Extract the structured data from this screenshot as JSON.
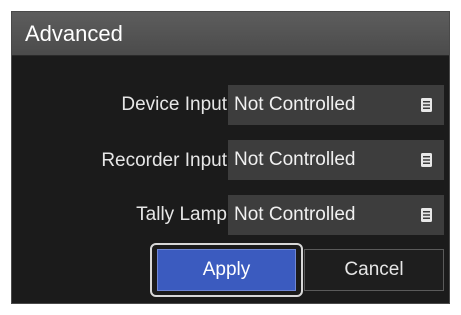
{
  "dialog": {
    "title": "Advanced"
  },
  "fields": [
    {
      "label": "Device Input",
      "value": "Not Controlled",
      "icon": "list-icon"
    },
    {
      "label": "Recorder Input",
      "value": "Not Controlled",
      "icon": "list-icon"
    },
    {
      "label": "Tally Lamp",
      "value": "Not Controlled",
      "icon": "list-icon"
    }
  ],
  "buttons": {
    "apply": "Apply",
    "cancel": "Cancel"
  },
  "colors": {
    "background": "#1b1b1b",
    "titlebar": "#555555",
    "select_bg": "#3d3d3d",
    "accent": "#3b5bbf"
  }
}
